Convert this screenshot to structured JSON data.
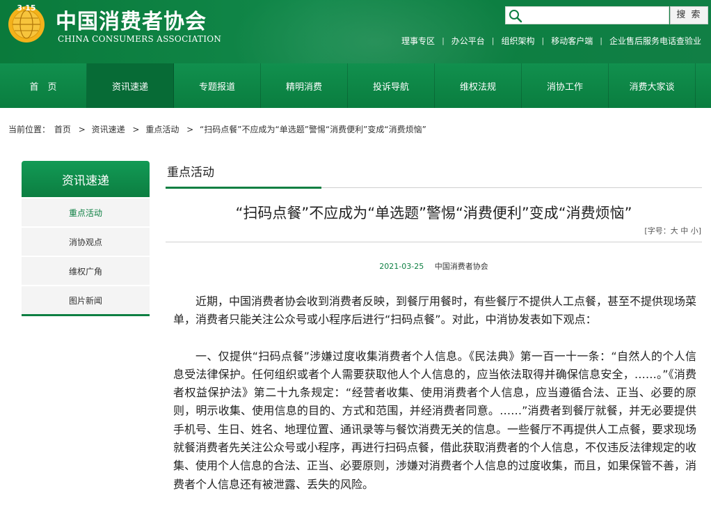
{
  "header": {
    "site_title": "中国消费者协会",
    "site_subtitle": "CHINA CONSUMERS ASSOCIATION",
    "logo_text": "3·15",
    "search_placeholder": "",
    "search_button": "搜 索",
    "top_links": [
      "理事专区",
      "办公平台",
      "组织架构",
      "移动客户端",
      "企业售后服务电话查验业"
    ]
  },
  "nav": {
    "items": [
      "首　页",
      "资讯速递",
      "专题报道",
      "精明消费",
      "投诉导航",
      "维权法规",
      "消协工作",
      "消费大家谈"
    ],
    "active_index": 1
  },
  "breadcrumb": {
    "label": "当前位置：",
    "items": [
      "首页",
      "资讯速递",
      "重点活动",
      "“扫码点餐”不应成为“单选题”警惕“消费便利”变成“消费烦恼”"
    ]
  },
  "sidebar": {
    "title": "资讯速递",
    "links": [
      "重点活动",
      "消协观点",
      "维权广角",
      "图片新闻"
    ],
    "active_index": 0
  },
  "section": {
    "title": "重点活动"
  },
  "article": {
    "title": "“扫码点餐”不应成为“单选题”警惕“消费便利”变成“消费烦恼”",
    "font_size_control": "[字号：大 中 小]",
    "date": "2021-03-25",
    "source": "中国消费者协会",
    "paragraphs": [
      "近期，中国消费者协会收到消费者反映，到餐厅用餐时，有些餐厅不提供人工点餐，甚至不提供现场菜单，消费者只能关注公众号或小程序后进行“扫码点餐”。对此，中消协发表如下观点：",
      "一、仅提供“扫码点餐”涉嫌过度收集消费者个人信息。《民法典》第一百一十一条：“自然人的个人信息受法律保护。任何组织或者个人需要获取他人个人信息的，应当依法取得并确保信息安全，……。”《消费者权益保护法》第二十九条规定：“经营者收集、使用消费者个人信息，应当遵循合法、正当、必要的原则，明示收集、使用信息的目的、方式和范围，并经消费者同意。……”消费者到餐厅就餐，并无必要提供手机号、生日、姓名、地理位置、通讯录等与餐饮消费无关的信息。一些餐厅不再提供人工点餐，要求现场就餐消费者先关注公众号或小程序，再进行扫码点餐，借此获取消费者的个人信息，不仅违反法律规定的收集、使用个人信息的合法、正当、必要原则，涉嫌对消费者个人信息的过度收集，而且，如果保管不善，消费者个人信息还有被泄露、丢失的风险。"
    ]
  },
  "colors": {
    "brand_green": "#0d7f42",
    "logo_gold": "#f3b21b"
  }
}
